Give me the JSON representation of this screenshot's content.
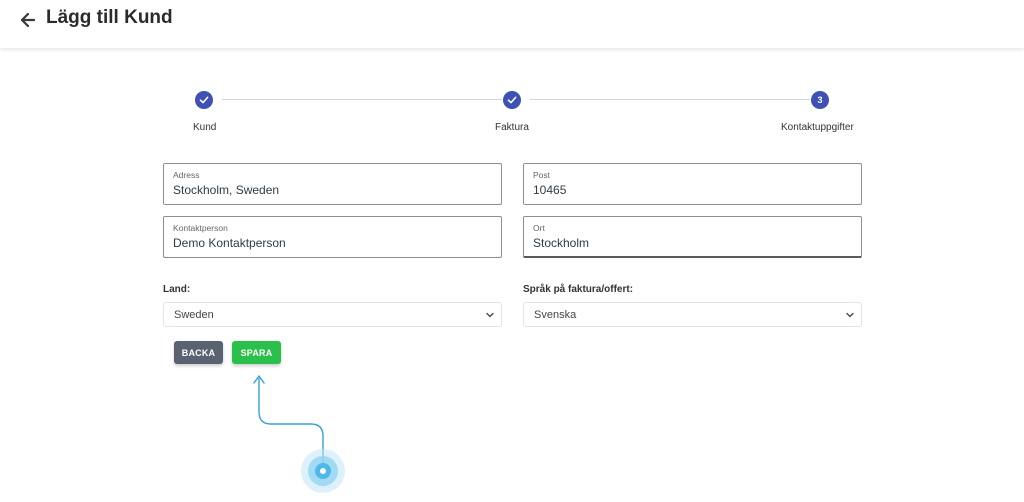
{
  "header": {
    "title": "Lägg till Kund",
    "back_icon": "arrow-left-icon"
  },
  "stepper": {
    "steps": [
      {
        "label": "Kund",
        "state": "done",
        "icon": "check-icon"
      },
      {
        "label": "Faktura",
        "state": "done",
        "icon": "check-icon"
      },
      {
        "label": "Kontaktuppgifter",
        "state": "active",
        "number": "3"
      }
    ],
    "accent_color": "#3f51b5"
  },
  "form": {
    "address": {
      "label": "Adress",
      "value": "Stockholm, Sweden"
    },
    "post": {
      "label": "Post",
      "value": "10465"
    },
    "contact": {
      "label": "Kontaktperson",
      "value": "Demo Kontaktperson"
    },
    "city": {
      "label": "Ort",
      "value": "Stockholm"
    },
    "country": {
      "label": "Land:",
      "value": "Sweden"
    },
    "language": {
      "label": "Språk på faktura/offert:",
      "value": "Svenska"
    }
  },
  "buttons": {
    "back": "BACKA",
    "save": "SPARA",
    "back_color": "#596270",
    "save_color": "#2bbf4b"
  }
}
